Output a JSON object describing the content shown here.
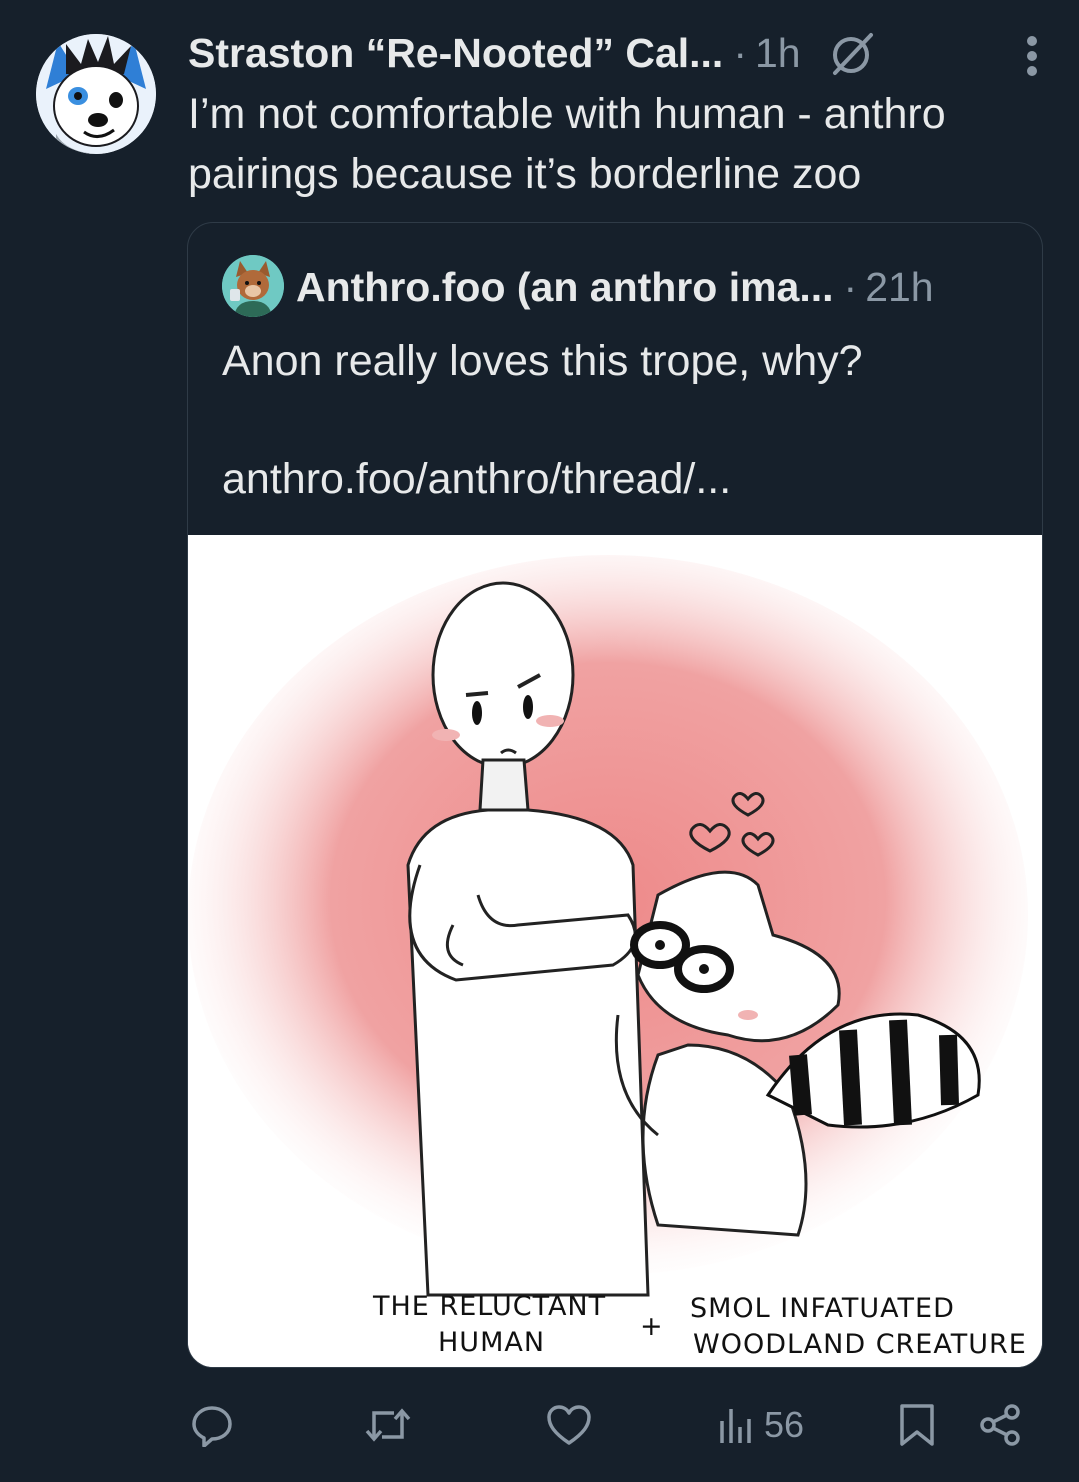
{
  "post": {
    "author": "Straston “Re-Nooted” Cal...",
    "time": "1h",
    "text": "I’m not comfortable with human - anthro pairings because it’s borderline zoo",
    "badge_icon": "empty-set-badge-icon",
    "more_icon": "more-vertical-icon"
  },
  "quote": {
    "author": "Anthro.foo (an anthro ima...",
    "time": "21h",
    "text": "Anon really loves this trope, why?",
    "link": "anthro.foo/anthro/thread/...",
    "image": {
      "caption_left_line1": "THE RELUCTANT",
      "caption_left_line2": "HUMAN",
      "caption_plus": "+",
      "caption_right_line1": "SMOL INFATUATED",
      "caption_right_line2": "WOODLAND CREATURE"
    }
  },
  "actions": {
    "reply_icon": "reply-icon",
    "repost_icon": "repost-icon",
    "like_icon": "heart-icon",
    "views_icon": "views-chart-icon",
    "views_count": "56",
    "bookmark_icon": "bookmark-icon",
    "share_icon": "share-icon"
  },
  "colors": {
    "background": "#16202b",
    "text": "#e7e9ea",
    "muted": "#8b98a5",
    "border": "#2f3b47",
    "pink_blush": "#ef8f8f"
  }
}
